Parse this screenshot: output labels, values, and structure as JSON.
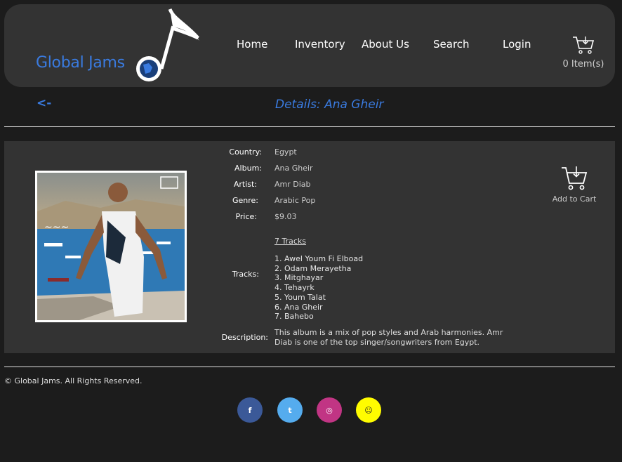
{
  "brand": {
    "name": "Global Jams"
  },
  "nav": [
    {
      "label": "Home"
    },
    {
      "label": "Inventory"
    },
    {
      "label": "About Us"
    },
    {
      "label": "Search"
    },
    {
      "label": "Login"
    }
  ],
  "cart": {
    "count_label": "0 Item(s)"
  },
  "page": {
    "back_label": "<-",
    "title": "Details: Ana Gheir"
  },
  "details": {
    "country_label": "Country:",
    "country": "Egypt",
    "album_label": "Album:",
    "album": "Ana Gheir",
    "artist_label": "Artist:",
    "artist": "Amr Diab",
    "genre_label": "Genre:",
    "genre": "Arabic Pop",
    "price_label": "Price:",
    "price": "$9.03",
    "tracks_label": "Tracks:",
    "tracks_link": "7 Tracks",
    "tracks": [
      "1. Awel Youm Fi Elboad",
      "2. Odam Merayetha",
      "3. Mitghayar",
      "4. Tehayrk",
      "5. Youm Talat",
      "6. Ana Gheir",
      "7. Bahebo"
    ],
    "description_label": "Description:",
    "description": "This album is a mix of pop styles and Arab harmonies. Amr Diab is one of the top singer/songwriters from Egypt."
  },
  "add_to_cart": {
    "label": "Add to Cart"
  },
  "footer": {
    "copyright": "© Global Jams. All Rights Reserved."
  },
  "social": [
    {
      "icon": "facebook-icon",
      "glyph": "f",
      "color": "#3b5998"
    },
    {
      "icon": "twitter-icon",
      "glyph": "t",
      "color": "#55acee"
    },
    {
      "icon": "instagram-icon",
      "glyph": "◎",
      "color": "#c13584"
    },
    {
      "icon": "snapchat-icon",
      "glyph": "☺",
      "color": "#fffc00"
    }
  ],
  "colors": {
    "accent": "#3a7be0",
    "panel": "#333333",
    "background": "#1c1c1c"
  }
}
